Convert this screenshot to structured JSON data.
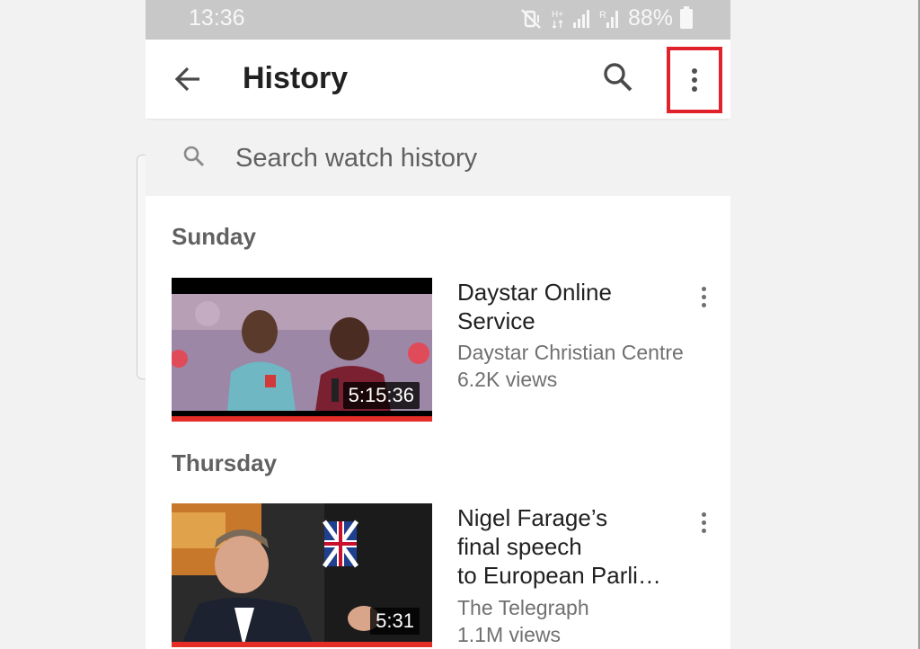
{
  "status_bar": {
    "time": "13:36",
    "battery": "88%",
    "icons": [
      "mute-vibrate-icon",
      "hplus-signal-icon",
      "signal-bars-icon",
      "roaming-signal-icon",
      "battery-icon"
    ]
  },
  "app_bar": {
    "title": "History",
    "back_icon": "arrow-back-icon",
    "search_icon": "search-icon",
    "more_icon": "more-vert-icon",
    "highlight_color": "#e0222c"
  },
  "search": {
    "placeholder": "Search watch history"
  },
  "sections": [
    {
      "heading": "Sunday",
      "videos": [
        {
          "title_line1": "Daystar Online",
          "title_line2": "Service",
          "channel": "Daystar Christian Centre",
          "views": "6.2K views",
          "duration": "5:15:36",
          "watched_fraction": 1.0
        }
      ]
    },
    {
      "heading": "Thursday",
      "videos": [
        {
          "title_line1": "Nigel Farage’s",
          "title_line2": "final speech",
          "title_line3": "to European Parli…",
          "channel": "The Telegraph",
          "views": "1.1M views",
          "duration": "5:31",
          "watched_fraction": 1.0
        }
      ]
    }
  ],
  "colors": {
    "accent_red": "#e52d27",
    "status_bar_bg": "#c8c8c8",
    "search_bg": "#f2f2f2"
  }
}
